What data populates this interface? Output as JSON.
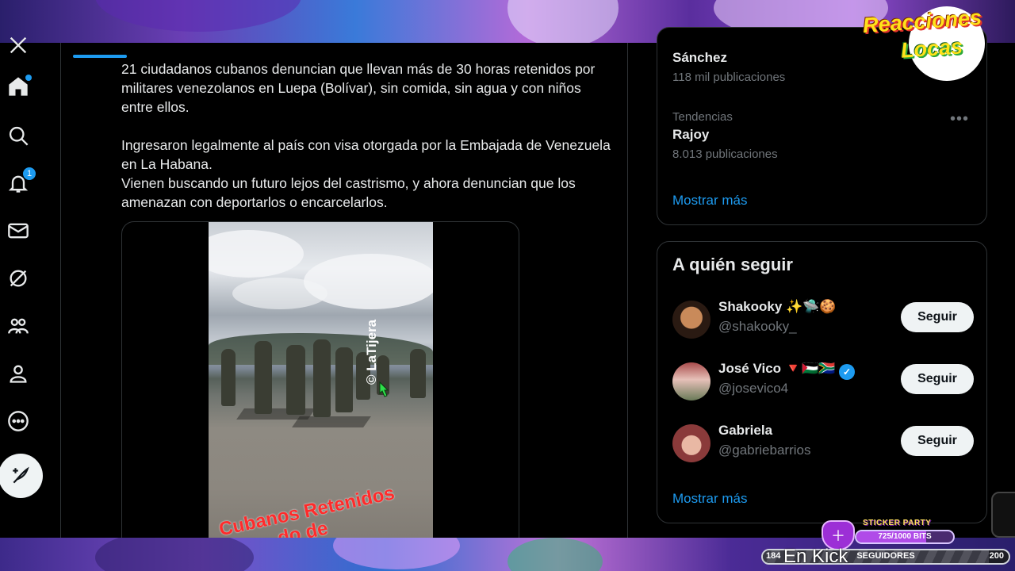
{
  "tweet": {
    "line1": "21 ciudadanos cubanos denuncian que llevan más de 30 horas retenidos por militares venezolanos en Luepa (Bolívar), sin comida, sin agua y con niños entre ellos.",
    "line2": "Ingresaron legalmente al país con visa otorgada por la Embajada de Venezuela en La Habana.",
    "line3": "Vienen buscando un futuro lejos del castrismo, y ahora denuncian que los amenazan con deportarlos o encarcelarlos.",
    "video_watermark": "© LaTijera",
    "video_caption_1": "Cubanos Retenidos",
    "video_caption_2": "do de"
  },
  "nav": {
    "icons": [
      "x-logo-icon",
      "home-icon",
      "search-icon",
      "bell-icon",
      "mail-icon",
      "grok-icon",
      "communities-icon",
      "profile-icon",
      "more-icon",
      "post-icon"
    ],
    "notif_count": "1"
  },
  "trends": {
    "top_partial_name": "Sánchez",
    "top_partial_count": "118 mil publicaciones",
    "category": "Tendencias",
    "name": "Rajoy",
    "count": "8.013 publicaciones",
    "show_more": "Mostrar más"
  },
  "who_to_follow": {
    "title": "A quién seguir",
    "users": [
      {
        "name": "Shakooky ✨🛸🍪",
        "handle": "@shakooky_",
        "button": "Seguir"
      },
      {
        "name": "José Vico 🔻🇵🇸🇿🇦",
        "handle": "@josevico4",
        "button": "Seguir",
        "verified": true
      },
      {
        "name": "Gabriela",
        "handle": "@gabriebarrios",
        "button": "Seguir"
      }
    ],
    "show_more": "Mostrar más"
  },
  "overlay": {
    "logo_line1": "Reacciones",
    "logo_line2": "Locas",
    "sticker_title": "STICKER PARTY",
    "sticker_progress": "725/1000 BITS",
    "sticker_fraction": 0.725,
    "followers_current": "184",
    "followers_label": "SEGUIDORES",
    "followers_goal": "200",
    "followers_fraction": 0.92,
    "kick_text": "En Kick"
  },
  "colors": {
    "accent": "#1d9bf0",
    "background": "#000000",
    "text": "#e7e9ea",
    "muted": "#71767b",
    "border": "#2f3336"
  }
}
